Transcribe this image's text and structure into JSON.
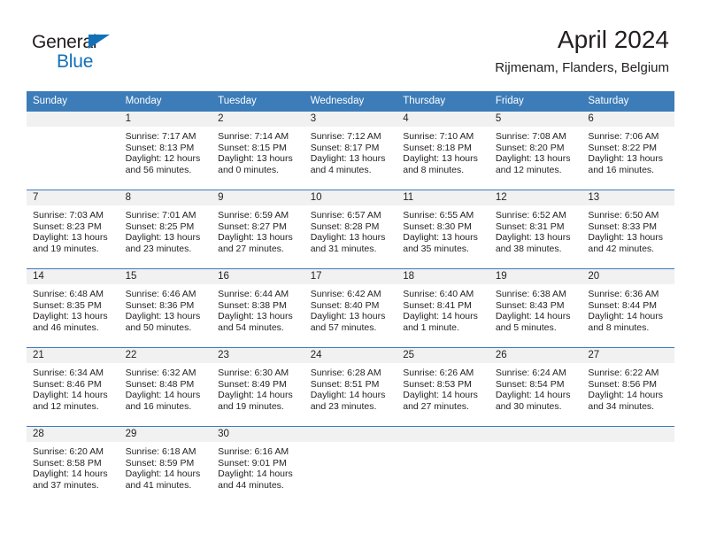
{
  "logo": {
    "word1": "General",
    "word2": "Blue",
    "triangle_color": "#1270b9"
  },
  "header": {
    "title": "April 2024",
    "subtitle": "Rijmenam, Flanders, Belgium"
  },
  "theme": {
    "header_blue": "#3b7cb9",
    "daynum_bg": "#f1f1f1",
    "text": "#231f20"
  },
  "weekdays": [
    "Sunday",
    "Monday",
    "Tuesday",
    "Wednesday",
    "Thursday",
    "Friday",
    "Saturday"
  ],
  "weeks": [
    [
      {
        "day": "",
        "lines": []
      },
      {
        "day": "1",
        "lines": [
          "Sunrise: 7:17 AM",
          "Sunset: 8:13 PM",
          "Daylight: 12 hours",
          "and 56 minutes."
        ]
      },
      {
        "day": "2",
        "lines": [
          "Sunrise: 7:14 AM",
          "Sunset: 8:15 PM",
          "Daylight: 13 hours",
          "and 0 minutes."
        ]
      },
      {
        "day": "3",
        "lines": [
          "Sunrise: 7:12 AM",
          "Sunset: 8:17 PM",
          "Daylight: 13 hours",
          "and 4 minutes."
        ]
      },
      {
        "day": "4",
        "lines": [
          "Sunrise: 7:10 AM",
          "Sunset: 8:18 PM",
          "Daylight: 13 hours",
          "and 8 minutes."
        ]
      },
      {
        "day": "5",
        "lines": [
          "Sunrise: 7:08 AM",
          "Sunset: 8:20 PM",
          "Daylight: 13 hours",
          "and 12 minutes."
        ]
      },
      {
        "day": "6",
        "lines": [
          "Sunrise: 7:06 AM",
          "Sunset: 8:22 PM",
          "Daylight: 13 hours",
          "and 16 minutes."
        ]
      }
    ],
    [
      {
        "day": "7",
        "lines": [
          "Sunrise: 7:03 AM",
          "Sunset: 8:23 PM",
          "Daylight: 13 hours",
          "and 19 minutes."
        ]
      },
      {
        "day": "8",
        "lines": [
          "Sunrise: 7:01 AM",
          "Sunset: 8:25 PM",
          "Daylight: 13 hours",
          "and 23 minutes."
        ]
      },
      {
        "day": "9",
        "lines": [
          "Sunrise: 6:59 AM",
          "Sunset: 8:27 PM",
          "Daylight: 13 hours",
          "and 27 minutes."
        ]
      },
      {
        "day": "10",
        "lines": [
          "Sunrise: 6:57 AM",
          "Sunset: 8:28 PM",
          "Daylight: 13 hours",
          "and 31 minutes."
        ]
      },
      {
        "day": "11",
        "lines": [
          "Sunrise: 6:55 AM",
          "Sunset: 8:30 PM",
          "Daylight: 13 hours",
          "and 35 minutes."
        ]
      },
      {
        "day": "12",
        "lines": [
          "Sunrise: 6:52 AM",
          "Sunset: 8:31 PM",
          "Daylight: 13 hours",
          "and 38 minutes."
        ]
      },
      {
        "day": "13",
        "lines": [
          "Sunrise: 6:50 AM",
          "Sunset: 8:33 PM",
          "Daylight: 13 hours",
          "and 42 minutes."
        ]
      }
    ],
    [
      {
        "day": "14",
        "lines": [
          "Sunrise: 6:48 AM",
          "Sunset: 8:35 PM",
          "Daylight: 13 hours",
          "and 46 minutes."
        ]
      },
      {
        "day": "15",
        "lines": [
          "Sunrise: 6:46 AM",
          "Sunset: 8:36 PM",
          "Daylight: 13 hours",
          "and 50 minutes."
        ]
      },
      {
        "day": "16",
        "lines": [
          "Sunrise: 6:44 AM",
          "Sunset: 8:38 PM",
          "Daylight: 13 hours",
          "and 54 minutes."
        ]
      },
      {
        "day": "17",
        "lines": [
          "Sunrise: 6:42 AM",
          "Sunset: 8:40 PM",
          "Daylight: 13 hours",
          "and 57 minutes."
        ]
      },
      {
        "day": "18",
        "lines": [
          "Sunrise: 6:40 AM",
          "Sunset: 8:41 PM",
          "Daylight: 14 hours",
          "and 1 minute."
        ]
      },
      {
        "day": "19",
        "lines": [
          "Sunrise: 6:38 AM",
          "Sunset: 8:43 PM",
          "Daylight: 14 hours",
          "and 5 minutes."
        ]
      },
      {
        "day": "20",
        "lines": [
          "Sunrise: 6:36 AM",
          "Sunset: 8:44 PM",
          "Daylight: 14 hours",
          "and 8 minutes."
        ]
      }
    ],
    [
      {
        "day": "21",
        "lines": [
          "Sunrise: 6:34 AM",
          "Sunset: 8:46 PM",
          "Daylight: 14 hours",
          "and 12 minutes."
        ]
      },
      {
        "day": "22",
        "lines": [
          "Sunrise: 6:32 AM",
          "Sunset: 8:48 PM",
          "Daylight: 14 hours",
          "and 16 minutes."
        ]
      },
      {
        "day": "23",
        "lines": [
          "Sunrise: 6:30 AM",
          "Sunset: 8:49 PM",
          "Daylight: 14 hours",
          "and 19 minutes."
        ]
      },
      {
        "day": "24",
        "lines": [
          "Sunrise: 6:28 AM",
          "Sunset: 8:51 PM",
          "Daylight: 14 hours",
          "and 23 minutes."
        ]
      },
      {
        "day": "25",
        "lines": [
          "Sunrise: 6:26 AM",
          "Sunset: 8:53 PM",
          "Daylight: 14 hours",
          "and 27 minutes."
        ]
      },
      {
        "day": "26",
        "lines": [
          "Sunrise: 6:24 AM",
          "Sunset: 8:54 PM",
          "Daylight: 14 hours",
          "and 30 minutes."
        ]
      },
      {
        "day": "27",
        "lines": [
          "Sunrise: 6:22 AM",
          "Sunset: 8:56 PM",
          "Daylight: 14 hours",
          "and 34 minutes."
        ]
      }
    ],
    [
      {
        "day": "28",
        "lines": [
          "Sunrise: 6:20 AM",
          "Sunset: 8:58 PM",
          "Daylight: 14 hours",
          "and 37 minutes."
        ]
      },
      {
        "day": "29",
        "lines": [
          "Sunrise: 6:18 AM",
          "Sunset: 8:59 PM",
          "Daylight: 14 hours",
          "and 41 minutes."
        ]
      },
      {
        "day": "30",
        "lines": [
          "Sunrise: 6:16 AM",
          "Sunset: 9:01 PM",
          "Daylight: 14 hours",
          "and 44 minutes."
        ]
      },
      {
        "day": "",
        "lines": []
      },
      {
        "day": "",
        "lines": []
      },
      {
        "day": "",
        "lines": []
      },
      {
        "day": "",
        "lines": []
      }
    ]
  ]
}
